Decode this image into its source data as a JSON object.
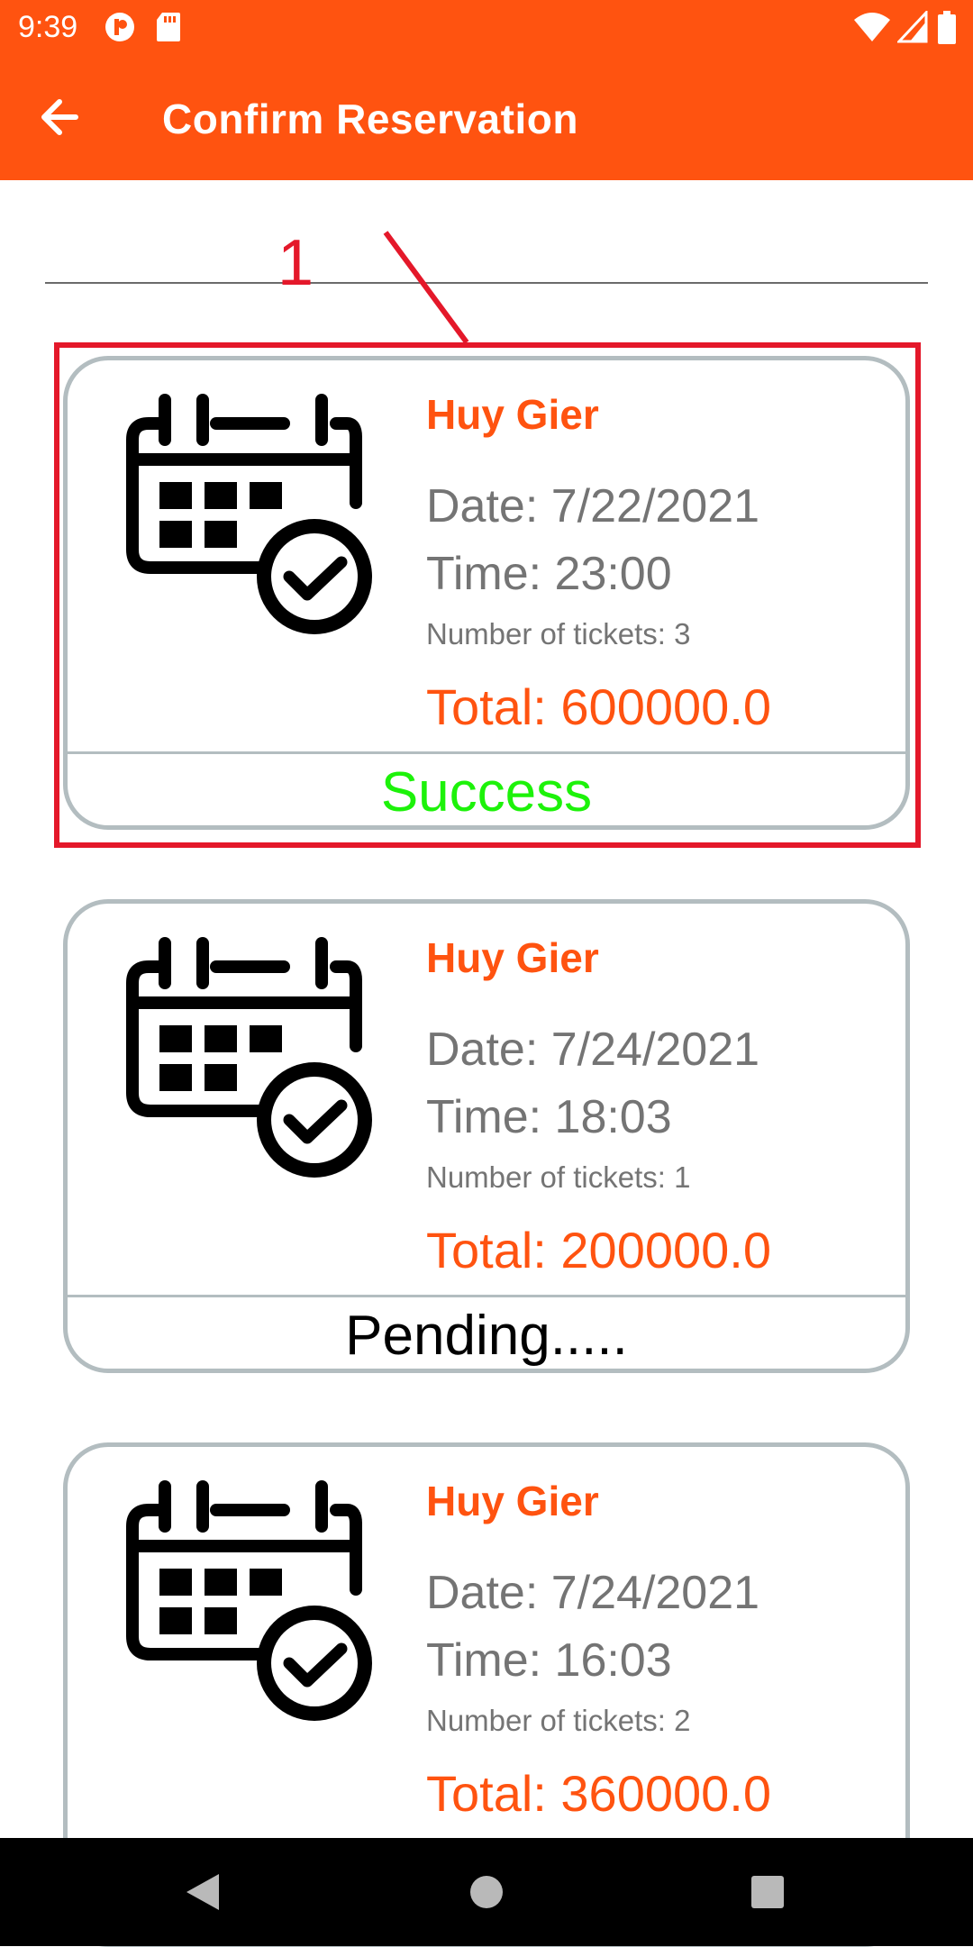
{
  "status_bar": {
    "time": "9:39",
    "icons": [
      "app-notification-icon",
      "sd-card-icon",
      "wifi-icon",
      "cell-signal-icon",
      "battery-icon"
    ]
  },
  "app_bar": {
    "title": "Confirm Reservation",
    "back_icon": "arrow-back-icon",
    "background": "#ff5310"
  },
  "annotation": {
    "number": "1",
    "color": "#e4182a"
  },
  "reservations": [
    {
      "name": "Huy Gier",
      "date": "Date: 7/22/2021",
      "time": "Time: 23:00",
      "tickets": "Number of tickets: 3",
      "total": "Total: 600000.0",
      "status": "Success",
      "status_color": "#1df20a"
    },
    {
      "name": "Huy Gier",
      "date": "Date: 7/24/2021",
      "time": "Time: 18:03",
      "tickets": "Number of tickets: 1",
      "total": "Total: 200000.0",
      "status": "Pending.....",
      "status_color": "#000000"
    },
    {
      "name": "Huy Gier",
      "date": "Date: 7/24/2021",
      "time": "Time: 16:03",
      "tickets": "Number of tickets: 2",
      "total": "Total: 360000.0",
      "status": "",
      "status_color": "#000000"
    }
  ],
  "nav_bar": {
    "buttons": [
      "back-triangle-icon",
      "home-circle-icon",
      "recents-square-icon"
    ]
  }
}
